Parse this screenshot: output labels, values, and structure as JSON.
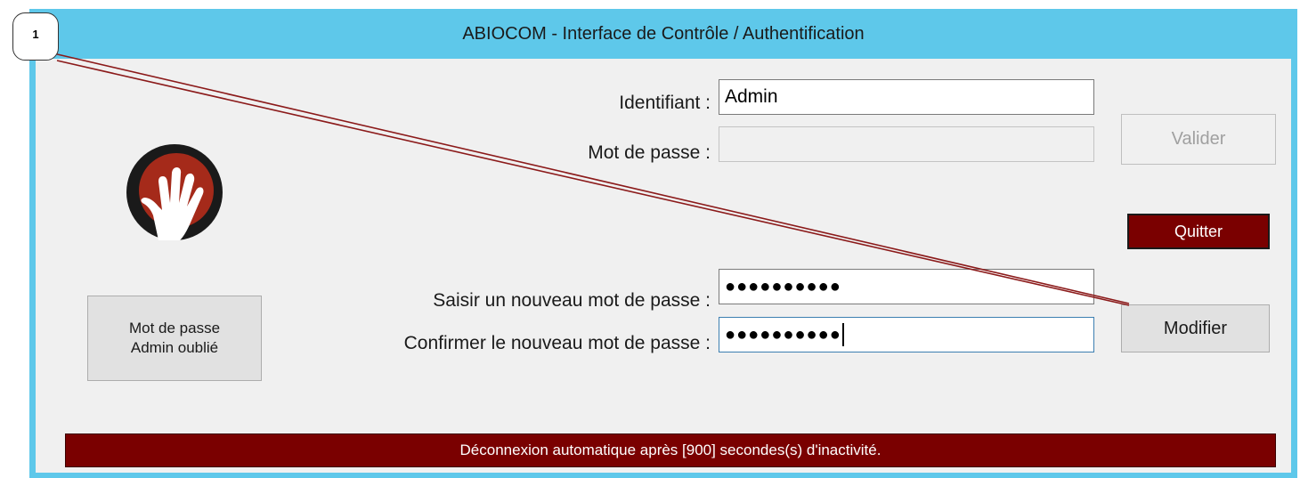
{
  "window": {
    "title": "ABIOCOM - Interface de Contrôle / Authentification"
  },
  "login": {
    "id_label": "Identifiant :",
    "id_value": "Admin",
    "password_label": "Mot de passe :",
    "password_value": "",
    "validate_label": "Valider",
    "quit_label": "Quitter"
  },
  "change_password": {
    "new_label": "Saisir un nouveau mot de passe :",
    "new_value": "●●●●●●●●●●",
    "confirm_label": "Confirmer le nouveau  mot de passe :",
    "confirm_value": "●●●●●●●●●●",
    "modify_label": "Modifier",
    "forgot_line1": "Mot de passe",
    "forgot_line2": "Admin oublié"
  },
  "status_bar": {
    "text": "Déconnexion automatique après [900] secondes(s) d'inactivité."
  },
  "annotation": {
    "callout_number": "1"
  },
  "colors": {
    "titlebar": "#5ec8ea",
    "client_bg": "#f0f0f0",
    "danger": "#7a0000",
    "button_bg": "#e1e1e1"
  },
  "icons": {
    "logo": "hand-stop-icon"
  }
}
